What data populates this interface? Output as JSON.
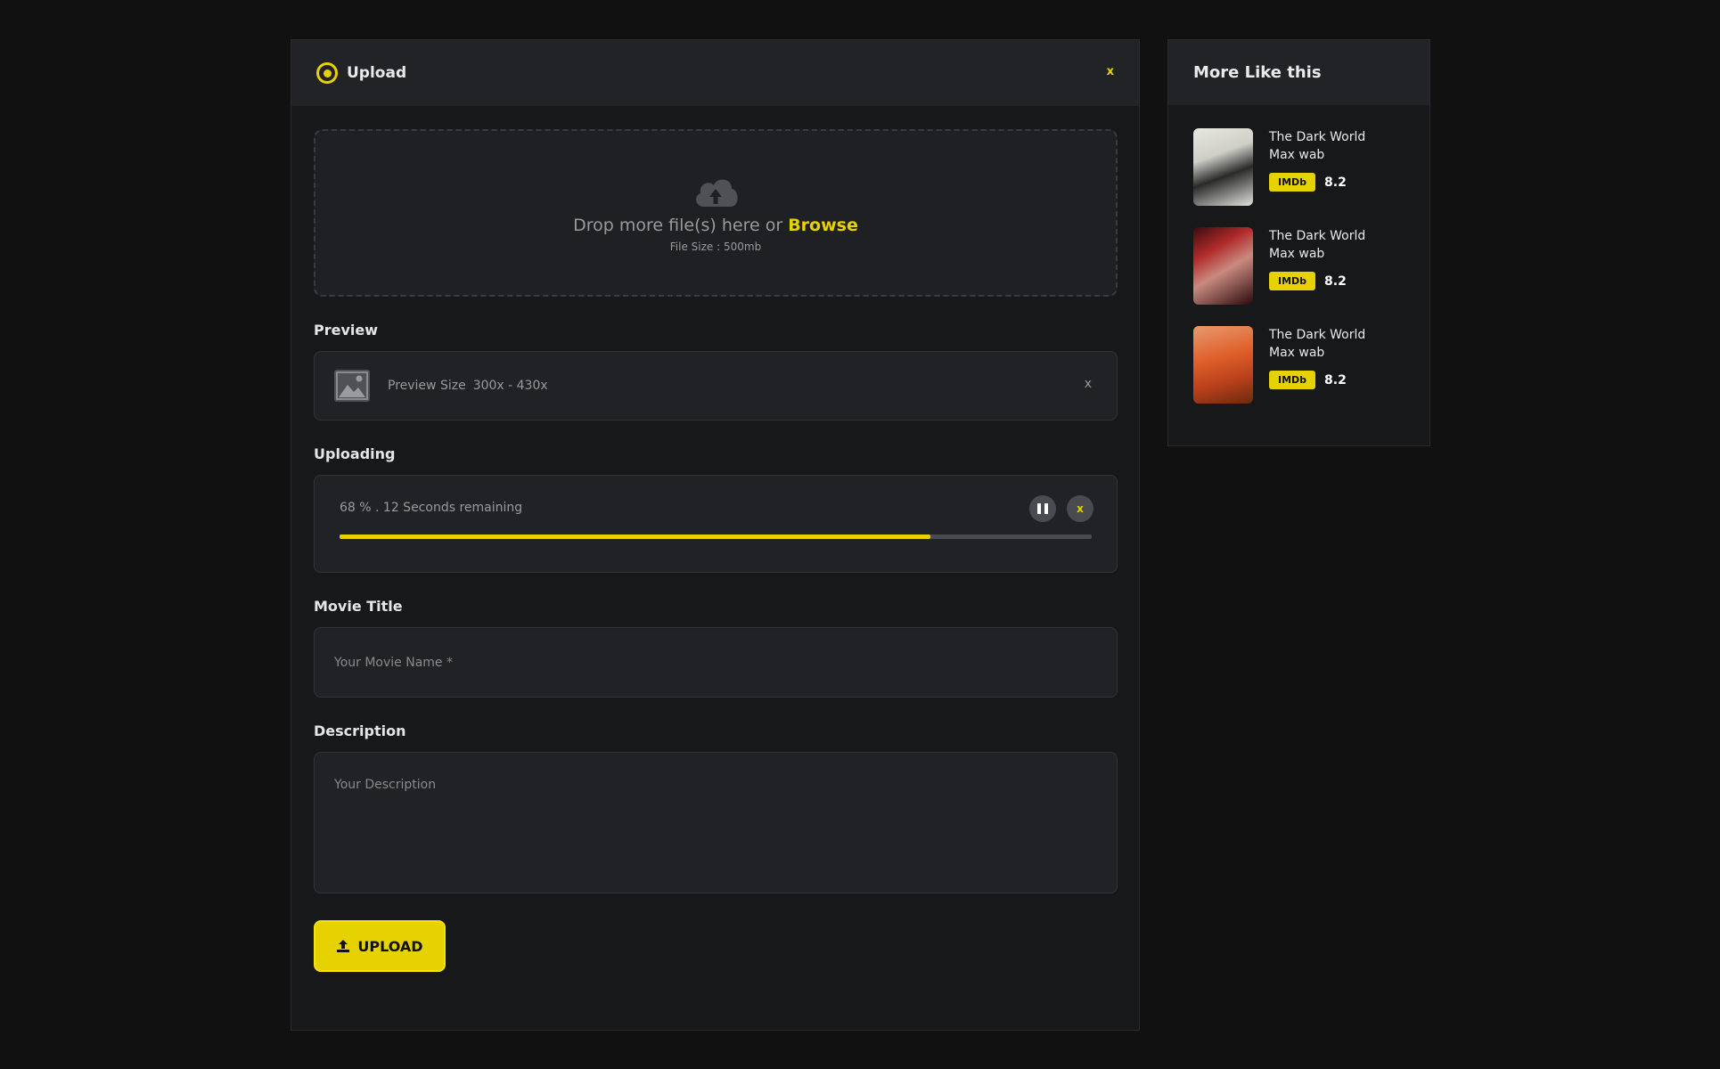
{
  "upload_panel": {
    "title": "Upload",
    "close_label": "x",
    "dropzone": {
      "text": "Drop more file(s) here or ",
      "browse_label": "Browse",
      "file_size": "File Size : 500mb"
    },
    "preview": {
      "label": "Preview",
      "size_label": "Preview Size",
      "size_value": "300x - 430x",
      "close_label": "x"
    },
    "uploading": {
      "label": "Uploading",
      "status": "68 % . 12 Seconds remaining",
      "progress_percent": 68,
      "cancel_label": "x"
    },
    "movie_title": {
      "label": "Movie Title",
      "placeholder": "Your Movie Name *"
    },
    "description": {
      "label": "Description",
      "placeholder": "Your Description"
    },
    "upload_button": "UPLOAD"
  },
  "sidebar": {
    "title": "More Like this",
    "items": [
      {
        "title": "The Dark World Max wab",
        "badge": "IMDb",
        "score": "8.2"
      },
      {
        "title": "The Dark World Max wab",
        "badge": "IMDb",
        "score": "8.2"
      },
      {
        "title": "The Dark World Max wab",
        "badge": "IMDb",
        "score": "8.2"
      }
    ]
  },
  "colors": {
    "accent": "#e6d200",
    "background": "#111112",
    "panel": "#17181a"
  },
  "icons": [
    "target-icon",
    "cloud-upload-icon",
    "image-icon",
    "pause-icon",
    "upload-arrow-icon"
  ]
}
